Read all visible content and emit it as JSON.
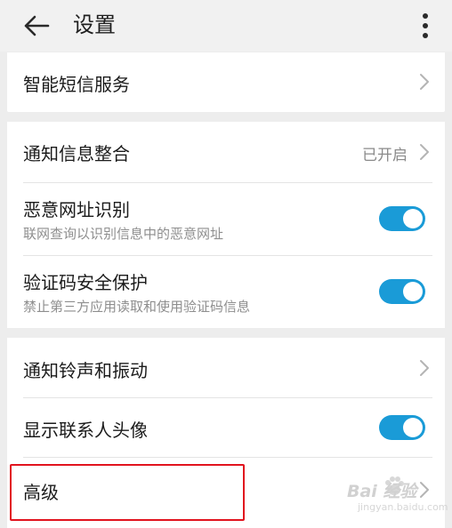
{
  "header": {
    "title": "设置",
    "back_icon": "back-arrow-icon",
    "more_icon": "more-vertical-icon"
  },
  "sections": {
    "smart_sms": {
      "label": "智能短信服务"
    },
    "notify_merge": {
      "label": "通知信息整合",
      "value": "已开启"
    },
    "malicious_url": {
      "label": "恶意网址识别",
      "sub": "联网查询以识别信息中的恶意网址",
      "on": true
    },
    "captcha_protect": {
      "label": "验证码安全保护",
      "sub": "禁止第三方应用读取和使用验证码信息",
      "on": true
    },
    "ringtone": {
      "label": "通知铃声和振动"
    },
    "contact_avatar": {
      "label": "显示联系人头像",
      "on": true
    },
    "advanced": {
      "label": "高级"
    }
  },
  "colors": {
    "accent": "#1a9bd7",
    "highlight": "#e1131e",
    "background": "#ededed"
  },
  "watermark": {
    "text": "Bai 经验",
    "sub": "jingyan.baidu.com"
  }
}
